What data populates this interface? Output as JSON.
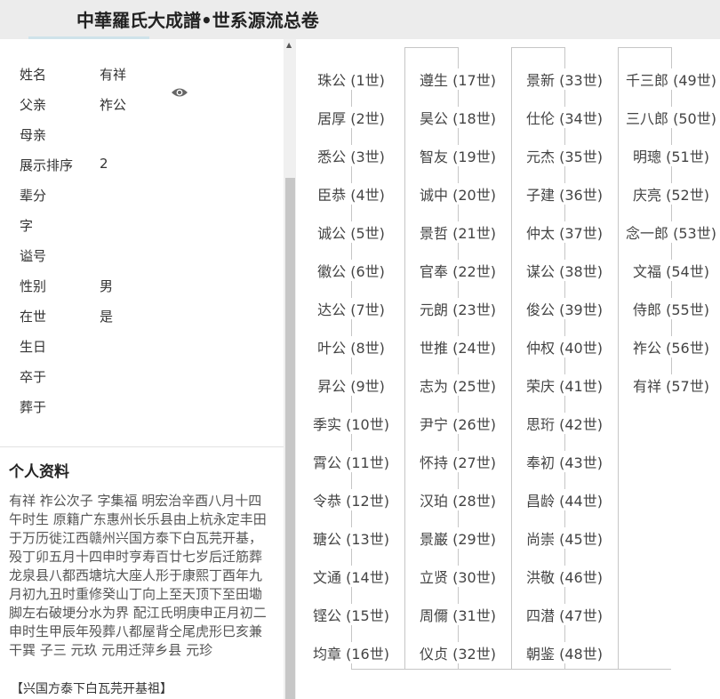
{
  "header": {
    "title": "中華羅氏大成譜•世系源流总卷"
  },
  "person": {
    "fields": [
      {
        "label": "姓名",
        "value": "有祥"
      },
      {
        "label": "父亲",
        "value": "祚公"
      },
      {
        "label": "母亲",
        "value": ""
      },
      {
        "label": "展示排序",
        "value": "2"
      },
      {
        "label": "辈分",
        "value": ""
      },
      {
        "label": "字",
        "value": ""
      },
      {
        "label": "谥号",
        "value": ""
      },
      {
        "label": "性别",
        "value": "男"
      },
      {
        "label": "在世",
        "value": "是"
      },
      {
        "label": "生日",
        "value": ""
      },
      {
        "label": "卒于",
        "value": ""
      },
      {
        "label": "葬于",
        "value": ""
      }
    ],
    "view_icon": "eye-icon"
  },
  "profile": {
    "title": "个人资料",
    "text": "有祥 祚公次子 字集福 明宏治辛酉八月十四午时生 原籍广东惠州长乐县由上杭永定丰田于万历徙江西赣州兴国方泰下白瓦芫开基，殁丁卯五月十四申时亨寿百廿七岁后迁筋葬龙泉县八都西塘坑大座人形于康熙丁酉年九月初九丑时重修癸山丁向上至天顶下至田墈脚左右破埂分水为界 配江氏明庚申正月初二申时生甲辰年殁葬八都屋背仝尾虎形巳亥兼干巽 子三 元玖 元用迁萍乡县 元珍",
    "tag": "【兴国方泰下白瓦芫开基祖】"
  },
  "lineage": [
    [
      "珠公 (1世)",
      "居厚 (2世)",
      "悉公 (3世)",
      "臣恭 (4世)",
      "诚公 (5世)",
      "徽公 (6世)",
      "达公 (7世)",
      "叶公 (8世)",
      "昇公 (9世)",
      "季实 (10世)",
      "霄公 (11世)",
      "令恭 (12世)",
      "瑭公 (13世)",
      "文通 (14世)",
      "铿公 (15世)",
      "均章 (16世)"
    ],
    [
      "遵生 (17世)",
      "昊公 (18世)",
      "智友 (19世)",
      "诚中 (20世)",
      "景哲 (21世)",
      "官奉 (22世)",
      "元朗 (23世)",
      "世推 (24世)",
      "志为 (25世)",
      "尹宁 (26世)",
      "怀持 (27世)",
      "汉珀 (28世)",
      "景巌 (29世)",
      "立贤 (30世)",
      "周儞 (31世)",
      "仪贞 (32世)"
    ],
    [
      "景新 (33世)",
      "仕伦 (34世)",
      "元杰 (35世)",
      "子建 (36世)",
      "仲太 (37世)",
      "谋公 (38世)",
      "俊公 (39世)",
      "仲权 (40世)",
      "荣庆 (41世)",
      "思珩 (42世)",
      "奉初 (43世)",
      "昌龄 (44世)",
      "尚崇 (45世)",
      "洪敬 (46世)",
      "四潜 (47世)",
      "朝鉴 (48世)"
    ],
    [
      "千三郎 (49世)",
      "三八郎 (50世)",
      "明璁 (51世)",
      "庆亮 (52世)",
      "念一郎 (53世)",
      "文福 (54世)",
      "侍郎 (55世)",
      "祚公 (56世)",
      "有祥 (57世)"
    ]
  ]
}
